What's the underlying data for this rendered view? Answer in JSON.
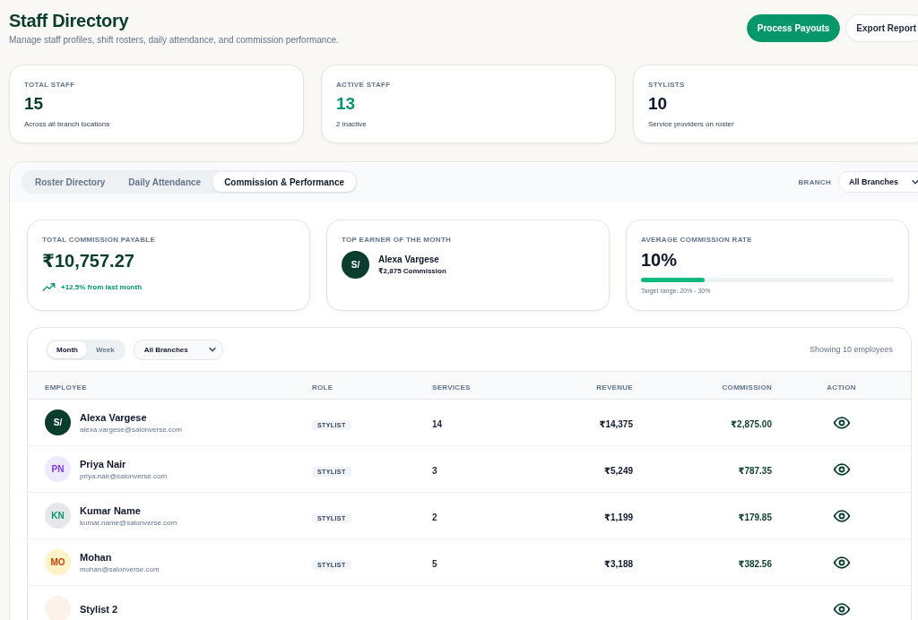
{
  "header": {
    "title": "Staff Directory",
    "subtitle": "Manage staff profiles, shift rosters, daily attendance, and commission performance.",
    "buttons": [
      {
        "label": "Process Payouts",
        "kind": "primary"
      },
      {
        "label": "Export Report",
        "kind": "secondary"
      }
    ]
  },
  "stats": [
    {
      "label": "TOTAL STAFF",
      "value": "15",
      "note": "Across all branch locations",
      "color": "#0b3d2e"
    },
    {
      "label": "ACTIVE STAFF",
      "value": "13",
      "note": "2 inactive",
      "color": "#059669"
    },
    {
      "label": "STYLISTS",
      "value": "10",
      "note": "Service providers on roster",
      "color": "#0f172a"
    }
  ],
  "tabs": [
    {
      "label": "Roster Directory",
      "selected": false
    },
    {
      "label": "Daily Attendance",
      "selected": false
    },
    {
      "label": "Commission & Performance",
      "selected": true
    }
  ],
  "branch_filter": {
    "label": "BRANCH",
    "value": "All Branches"
  },
  "summary": {
    "total": {
      "label": "TOTAL COMMISSION PAYABLE",
      "value": "₹10,757.27",
      "trend": "+12.5% from last month"
    },
    "top_earner": {
      "label": "TOP EARNER OF THE MONTH",
      "initials": "S/",
      "name": "Alexa Vargese",
      "amount": "₹2,875 Commission"
    },
    "average": {
      "label": "AVERAGE COMMISSION RATE",
      "value": "10%",
      "level": 0.25,
      "note": "Target range: 20% - 30%"
    }
  },
  "table": {
    "period": [
      {
        "label": "Month",
        "selected": true
      },
      {
        "label": "Week",
        "selected": false
      }
    ],
    "branch": "All Branches",
    "count": "Showing 10 employees",
    "columns": [
      "EMPLOYEE",
      "ROLE",
      "SERVICES",
      "REVENUE",
      "COMMISSION",
      "ACTION"
    ],
    "rows": [
      {
        "avatar": {
          "color": "#0b3d2e",
          "initials": {
            "text": "S/",
            "color": "#ffffff"
          }
        },
        "name": "Alexa Vargese",
        "email": "alexa.vargese@salonverse.com",
        "role": "STYLIST",
        "services": "14",
        "revenue": "₹14,375",
        "commission": "₹2,875.00"
      },
      {
        "avatar": {
          "color": "#ede9fe",
          "initials": {
            "text": "PN",
            "color": "#7c3aed"
          }
        },
        "name": "Priya Nair",
        "email": "priya.nair@salonverse.com",
        "role": "STYLIST",
        "services": "3",
        "revenue": "₹5,249",
        "commission": "₹787.35"
      },
      {
        "avatar": {
          "color": "#e5e7eb",
          "initials": {
            "text": "KN",
            "color": "#059669"
          }
        },
        "name": "Kumar Name",
        "email": "kumar.name@salonverse.com",
        "role": "STYLIST",
        "services": "2",
        "revenue": "₹1,199",
        "commission": "₹179.85"
      },
      {
        "avatar": {
          "color": "#fef3c7",
          "initials": {
            "text": "MO",
            "color": "#c2410c"
          }
        },
        "name": "Mohan",
        "email": "mohan@salonverse.com",
        "role": "STYLIST",
        "services": "5",
        "revenue": "₹3,188",
        "commission": "₹382.56"
      },
      {
        "avatar": {
          "color": "#fdf2e9"
        },
        "name": "Stylist 2"
      }
    ]
  }
}
